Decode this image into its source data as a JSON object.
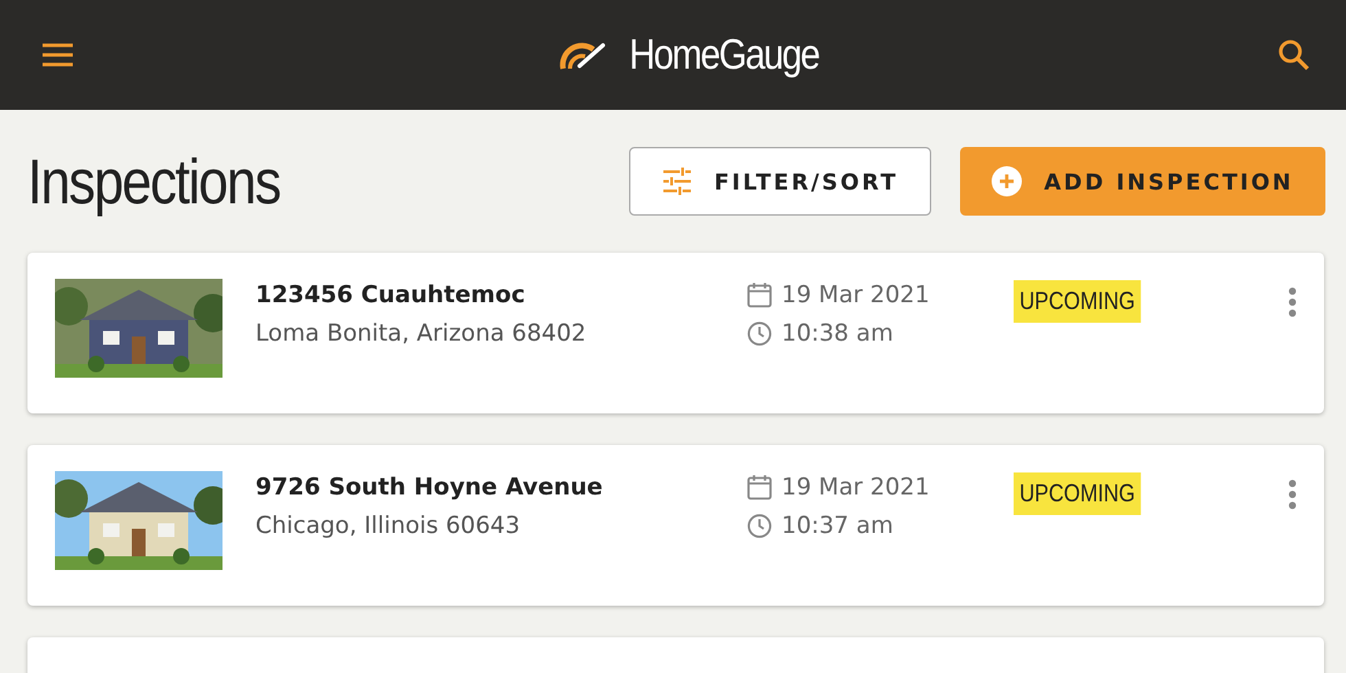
{
  "header": {
    "logo": "HomeGauge"
  },
  "page": {
    "title": "Inspections",
    "filter_button": "FILTER/SORT",
    "add_button": "ADD INSPECTION"
  },
  "inspections": [
    {
      "kind": "picture",
      "street": "123456 Cuauhtemoc",
      "city": "Loma Bonita, Arizona 68402",
      "date": "19 Mar 2021",
      "time": "10:38 am",
      "status": "UPCOMING"
    },
    {
      "kind": "picture",
      "street": "9726 South Hoyne Avenue",
      "city": "Chicago, Illinois 60643",
      "date": "19 Mar 2021",
      "time": "10:37 am",
      "status": "UPCOMING"
    }
  ]
}
